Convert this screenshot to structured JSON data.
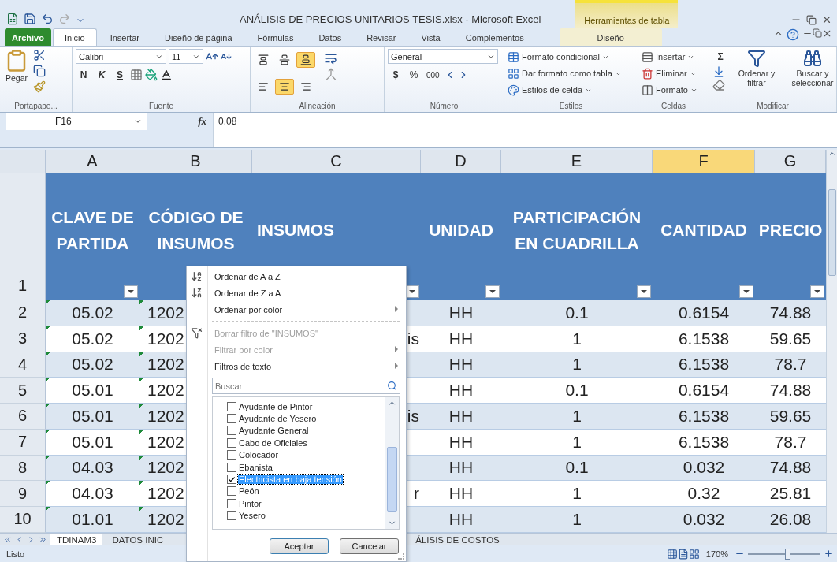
{
  "window": {
    "title": "ANÁLISIS DE PRECIOS UNITARIOS TESIS.xlsx - Microsoft Excel",
    "context_tab": "Herramientas de tabla"
  },
  "ribbon_tabs": [
    {
      "label": "Archivo",
      "kind": "file",
      "selected": false
    },
    {
      "label": "Inicio",
      "kind": "normal",
      "selected": true
    },
    {
      "label": "Insertar",
      "kind": "normal",
      "selected": false
    },
    {
      "label": "Diseño de página",
      "kind": "normal",
      "selected": false
    },
    {
      "label": "Fórmulas",
      "kind": "normal",
      "selected": false
    },
    {
      "label": "Datos",
      "kind": "normal",
      "selected": false
    },
    {
      "label": "Revisar",
      "kind": "normal",
      "selected": false
    },
    {
      "label": "Vista",
      "kind": "normal",
      "selected": false
    },
    {
      "label": "Complementos",
      "kind": "normal",
      "selected": false
    },
    {
      "label": "Diseño",
      "kind": "context",
      "selected": false
    }
  ],
  "ribbon": {
    "clipboard": {
      "paste": "Pegar",
      "label": "Portapape..."
    },
    "font": {
      "name": "Calibri",
      "size": "11",
      "bold": "N",
      "italic": "K",
      "underline": "S",
      "label": "Fuente"
    },
    "alignment": {
      "label": "Alineación",
      "buttons": [
        {
          "kind": "top",
          "selected": false
        },
        {
          "kind": "middle",
          "selected": false
        },
        {
          "kind": "bottom",
          "selected": true
        },
        {
          "kind": "left",
          "selected": false
        },
        {
          "kind": "center",
          "selected": true
        },
        {
          "kind": "right",
          "selected": false
        }
      ]
    },
    "number": {
      "format": "General",
      "currency": "$",
      "percent": "%",
      "thousands": "000",
      "label": "Número"
    },
    "styles": {
      "items": [
        "Formato condicional",
        "Dar formato como tabla",
        "Estilos de celda"
      ],
      "label": "Estilos"
    },
    "cells": {
      "items": [
        "Insertar",
        "Eliminar",
        "Formato"
      ],
      "label": "Celdas"
    },
    "editing": {
      "sum": "Σ",
      "sort": "Ordenar y filtrar",
      "find": "Buscar y seleccionar",
      "label": "Modificar"
    }
  },
  "formula_bar": {
    "name_box": "F16",
    "fx": "fx",
    "value": "0.08"
  },
  "columns": [
    {
      "label": "A",
      "selected": false
    },
    {
      "label": "B",
      "selected": false
    },
    {
      "label": "C",
      "selected": false
    },
    {
      "label": "D",
      "selected": false
    },
    {
      "label": "E",
      "selected": false
    },
    {
      "label": "F",
      "selected": true
    },
    {
      "label": "G",
      "selected": false
    }
  ],
  "header_row": {
    "row": "1",
    "cells": [
      "CLAVE DE PARTIDA",
      "CÓDIGO DE INSUMOS",
      "INSUMOS",
      "UNIDAD",
      "PARTICIPACIÓN EN CUADRILLA",
      "CANTIDAD",
      "PRECIO"
    ]
  },
  "rows": [
    {
      "row": "2",
      "a": "05.02",
      "b": "1202",
      "d": "HH",
      "e": "0.1",
      "f": "0.6154",
      "g": "74.88"
    },
    {
      "row": "3",
      "a": "05.02",
      "b": "1202",
      "c": "is",
      "d": "HH",
      "e": "1",
      "f": "6.1538",
      "g": "59.65"
    },
    {
      "row": "4",
      "a": "05.02",
      "b": "1202",
      "d": "HH",
      "e": "1",
      "f": "6.1538",
      "g": "78.7"
    },
    {
      "row": "5",
      "a": "05.01",
      "b": "1202",
      "d": "HH",
      "e": "0.1",
      "f": "0.6154",
      "g": "74.88"
    },
    {
      "row": "6",
      "a": "05.01",
      "b": "1202",
      "c": "is",
      "d": "HH",
      "e": "1",
      "f": "6.1538",
      "g": "59.65"
    },
    {
      "row": "7",
      "a": "05.01",
      "b": "1202",
      "d": "HH",
      "e": "1",
      "f": "6.1538",
      "g": "78.7"
    },
    {
      "row": "8",
      "a": "04.03",
      "b": "1202",
      "d": "HH",
      "e": "0.1",
      "f": "0.032",
      "g": "74.88"
    },
    {
      "row": "9",
      "a": "04.03",
      "b": "1202",
      "c": "r",
      "d": "HH",
      "e": "1",
      "f": "0.32",
      "g": "25.81"
    },
    {
      "row": "10",
      "a": "01.01",
      "b": "1202",
      "d": "HH",
      "e": "1",
      "f": "0.032",
      "g": "26.08"
    }
  ],
  "filter_menu": {
    "items": [
      {
        "kind": "sort_az",
        "label": "Ordenar de A a Z",
        "disabled": false,
        "submenu": false
      },
      {
        "kind": "sort_za",
        "label": "Ordenar de Z a A",
        "disabled": false,
        "submenu": false
      },
      {
        "kind": "plain",
        "label": "Ordenar por color",
        "disabled": false,
        "submenu": true
      },
      {
        "kind": "separator"
      },
      {
        "kind": "clear",
        "label": "Borrar filtro de \"INSUMOS\"",
        "disabled": true,
        "submenu": false
      },
      {
        "kind": "plain",
        "label": "Filtrar por color",
        "disabled": true,
        "submenu": true
      },
      {
        "kind": "plain",
        "label": "Filtros de texto",
        "disabled": false,
        "submenu": true
      }
    ],
    "search": {
      "placeholder": "Buscar"
    },
    "values": [
      {
        "label": "Ayudante de Pintor",
        "checked": false,
        "selected": false
      },
      {
        "label": "Ayudante de Yesero",
        "checked": false,
        "selected": false
      },
      {
        "label": "Ayudante General",
        "checked": false,
        "selected": false
      },
      {
        "label": "Cabo de Oficiales",
        "checked": false,
        "selected": false
      },
      {
        "label": "Colocador",
        "checked": false,
        "selected": false
      },
      {
        "label": "Ebanista",
        "checked": false,
        "selected": false
      },
      {
        "label": "Electricista en baja tensión",
        "checked": true,
        "selected": true
      },
      {
        "label": "Peón",
        "checked": false,
        "selected": false
      },
      {
        "label": "Pintor",
        "checked": false,
        "selected": false
      },
      {
        "label": "Yesero",
        "checked": false,
        "selected": false
      }
    ],
    "buttons": [
      "Aceptar",
      "Cancelar"
    ]
  },
  "sheet_tabs": [
    {
      "label": "TDINAM3",
      "selected": true
    },
    {
      "label": "DATOS INIC",
      "selected": false
    },
    {
      "label": "ÁLISIS DE COSTOS",
      "selected": false
    }
  ],
  "status_bar": {
    "text": "Listo",
    "zoom": "170%",
    "zoom_slider": {
      "level": 0.55
    }
  }
}
